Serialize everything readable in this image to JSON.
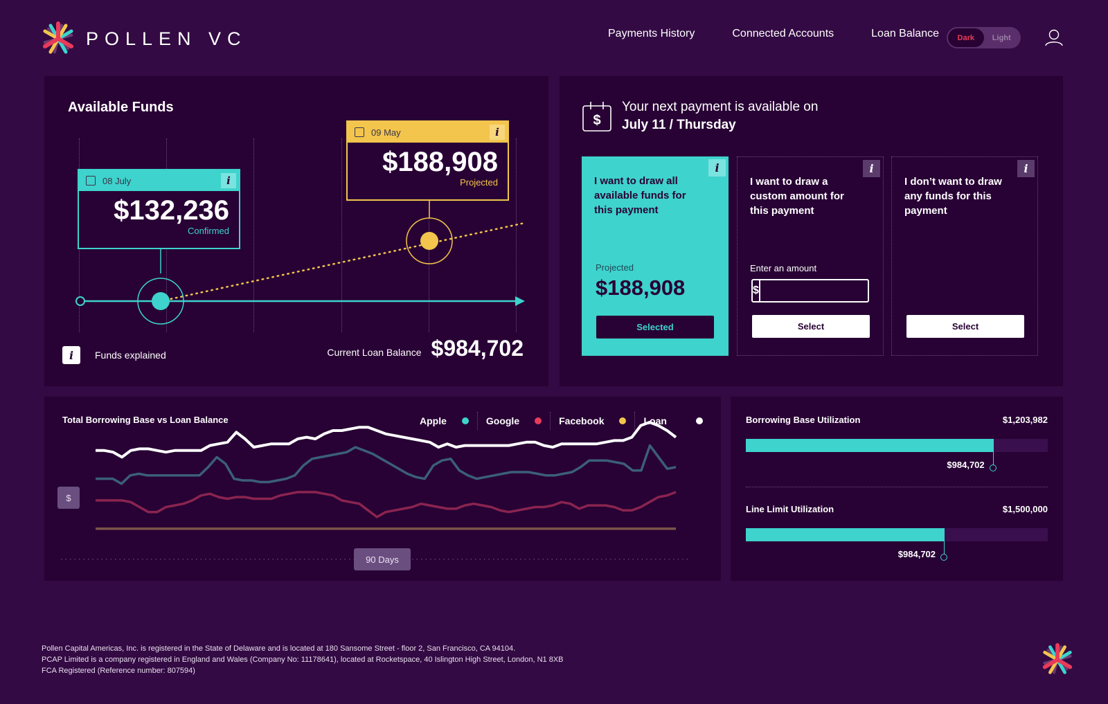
{
  "brand": {
    "name": "POLLEN VC",
    "logo_icon": "pollen-star-logo"
  },
  "nav": {
    "items": [
      {
        "label": "Payments History"
      },
      {
        "label": "Connected Accounts"
      },
      {
        "label": "Loan Balance"
      }
    ],
    "theme_toggle": {
      "options": [
        "Dark",
        "Light"
      ],
      "selected": "Dark"
    },
    "user_icon": "user-icon"
  },
  "colors": {
    "background": "#330a43",
    "panel": "#280234",
    "teal": "#3ed3cd",
    "yellow": "#f3c54d",
    "red": "#e83a5a",
    "white": "#ffffff"
  },
  "available_funds": {
    "title": "Available Funds",
    "confirmed": {
      "date": "08 July",
      "amount": "$132,236",
      "status": "Confirmed"
    },
    "projected": {
      "date": "09 May",
      "amount": "$188,908",
      "status": "Projected"
    },
    "funds_explained": "Funds explained",
    "info_glyph": "i",
    "loan_balance_label": "Current Loan Balance",
    "loan_balance_value": "$984,702"
  },
  "next_payment": {
    "line1": "Your next payment is available on",
    "line2": "July 11 / Thursday",
    "icon_glyph": "$",
    "options": [
      {
        "title": "I want to draw all available funds for this payment",
        "projected_label": "Projected",
        "projected_value": "$188,908",
        "button": "Selected",
        "selected": true
      },
      {
        "title": "I want to draw a custom amount for this payment",
        "input_label": "Enter an amount",
        "currency": "$",
        "input_value": "",
        "button": "Select",
        "selected": false
      },
      {
        "title": "I don’t want to draw any funds for this payment",
        "button": "Select",
        "selected": false
      }
    ]
  },
  "chart_data": {
    "type": "line",
    "title": "Total Borrowing Base vs Loan Balance",
    "y_badge": "$",
    "range_button": "90 Days",
    "legend": [
      {
        "name": "Apple",
        "color": "#3ed3cd"
      },
      {
        "name": "Google",
        "color": "#e83a5a"
      },
      {
        "name": "Facebook",
        "color": "#f3c54d"
      },
      {
        "name": "Loan",
        "color": "#ffffff"
      }
    ],
    "ylim": [
      0,
      100
    ],
    "series": [
      {
        "name": "Total",
        "color": "#ffffff",
        "values": [
          80,
          80,
          79,
          76,
          80,
          81,
          81,
          80,
          79,
          80,
          80,
          80,
          80,
          83,
          84,
          85,
          91,
          87,
          82,
          83,
          84,
          84,
          84,
          87,
          88,
          87,
          90,
          92,
          92,
          93,
          94,
          94,
          92,
          90,
          89,
          88,
          87,
          86,
          85,
          82,
          84,
          82,
          83,
          83,
          83,
          83,
          83,
          83,
          84,
          85,
          85,
          83,
          82,
          84,
          84,
          84,
          84,
          84,
          85,
          86,
          86,
          88,
          95,
          97,
          95,
          92,
          88
        ]
      },
      {
        "name": "Apple",
        "color": "#3b5f78",
        "values": [
          63,
          63,
          63,
          60,
          65,
          66,
          65,
          65,
          65,
          65,
          65,
          65,
          65,
          70,
          76,
          72,
          63,
          62,
          62,
          61,
          61,
          62,
          63,
          65,
          71,
          75,
          76,
          77,
          78,
          79,
          82,
          80,
          78,
          75,
          72,
          69,
          66,
          64,
          63,
          71,
          74,
          75,
          68,
          65,
          63,
          64,
          65,
          66,
          67,
          67,
          67,
          66,
          65,
          65,
          66,
          67,
          70,
          74,
          74,
          74,
          73,
          72,
          68,
          68,
          83,
          76,
          69,
          70
        ]
      },
      {
        "name": "Google",
        "color": "#8a2450",
        "values": [
          50,
          50,
          50,
          50,
          49,
          46,
          43,
          43,
          46,
          47,
          48,
          50,
          53,
          54,
          52,
          51,
          52,
          52,
          51,
          51,
          51,
          53,
          54,
          55,
          55,
          55,
          54,
          53,
          50,
          49,
          48,
          44,
          40,
          43,
          44,
          45,
          46,
          48,
          47,
          46,
          45,
          45,
          47,
          48,
          47,
          46,
          44,
          43,
          44,
          45,
          46,
          46,
          47,
          49,
          48,
          45,
          47,
          47,
          47,
          46,
          44,
          44,
          46,
          49,
          52,
          53,
          55
        ]
      },
      {
        "name": "Facebook",
        "color": "#7a5548",
        "values": [
          33,
          33,
          33,
          33,
          33,
          33,
          33,
          33,
          33,
          33,
          33,
          33,
          33,
          33,
          33,
          33,
          33,
          33,
          33,
          33,
          33,
          33,
          33,
          33,
          33,
          33,
          33,
          33,
          33,
          33,
          33,
          33,
          33,
          33,
          33,
          33,
          33,
          33,
          33,
          33,
          33,
          33,
          33,
          33,
          33,
          33,
          33,
          33,
          33,
          33,
          33,
          33,
          33,
          33,
          33,
          33,
          33,
          33,
          33,
          33,
          33,
          33,
          33,
          33,
          33,
          33,
          33
        ]
      }
    ],
    "xlabel": "",
    "ylabel": "$"
  },
  "utilization": [
    {
      "label": "Borrowing Base Utilization",
      "total": "$1,203,982",
      "used": "$984,702",
      "fraction": 0.818
    },
    {
      "label": "Line Limit Utilization",
      "total": "$1,500,000",
      "used": "$984,702",
      "fraction": 0.656
    }
  ],
  "footer": {
    "lines": [
      "Pollen Capital Americas, Inc. is registered in the State of Delaware and is located at 180 Sansome Street - floor 2, San Francisco, CA 94104.",
      "PCAP Limited is a company registered in England and Wales (Company No: 11178641), located at Rocketspace, 40 Islington High Street, London, N1 8XB",
      "FCA Registered (Reference number: 807594)"
    ]
  }
}
